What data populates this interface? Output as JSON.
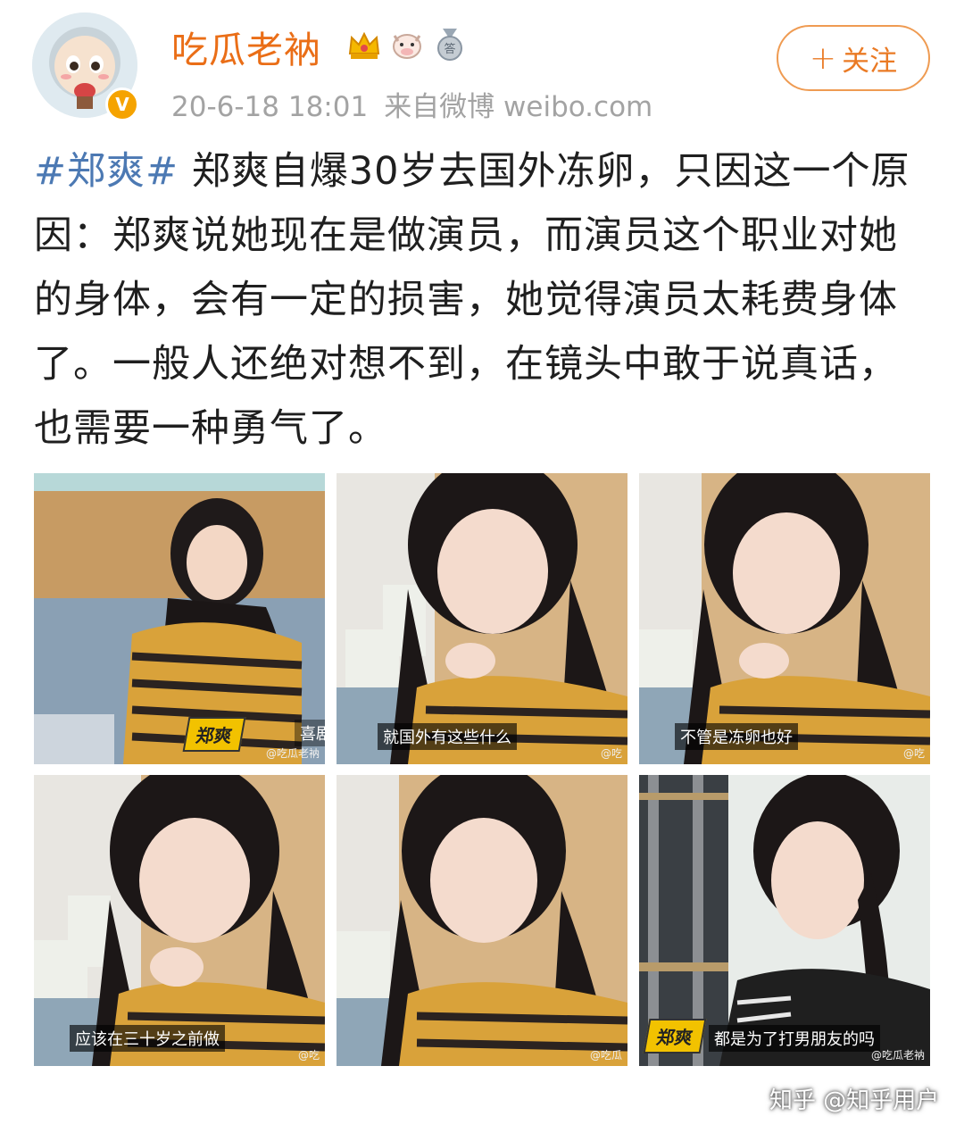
{
  "header": {
    "username": "吃瓜老衲",
    "date": "20-6-18 18:01",
    "source": "来自微博 weibo.com",
    "follow_label": "关注",
    "follow_icon": "plus-icon",
    "verified_badge": "V",
    "badge_icons": [
      "crown-icon",
      "cow-icon",
      "medal-icon"
    ]
  },
  "post": {
    "hashtag": "#郑爽#",
    "text": " 郑爽自爆30岁去国外冻卵，只因这一个原因：郑爽说她现在是做演员，而演员这个职业对她的身体，会有一定的损害，她觉得演员太耗费身体了。一般人还绝对想不到，在镜头中敢于说真话，也需要一种勇气了。"
  },
  "images": [
    {
      "name_tag": "郑爽",
      "caption": "",
      "side_text": "喜剧",
      "watermark": "@吃瓜老衲"
    },
    {
      "name_tag": "",
      "caption": "就国外有这些什么",
      "side_text": "",
      "watermark": "@吃"
    },
    {
      "name_tag": "",
      "caption": "不管是冻卵也好",
      "side_text": "",
      "watermark": "@吃"
    },
    {
      "name_tag": "",
      "caption": "应该在三十岁之前做",
      "side_text": "",
      "watermark": "@吃"
    },
    {
      "name_tag": "",
      "caption": "",
      "side_text": "",
      "watermark": "@吃瓜"
    },
    {
      "name_tag": "郑爽",
      "caption": "都是为了打男朋友的吗",
      "side_text": "",
      "watermark": "@吃瓜老衲"
    }
  ],
  "watermark": "知乎 @知乎用户",
  "colors": {
    "username": "#ea6e17",
    "hashtag": "#4c79b3",
    "follow": "#ea7a24",
    "meta": "#a3a3a3"
  }
}
